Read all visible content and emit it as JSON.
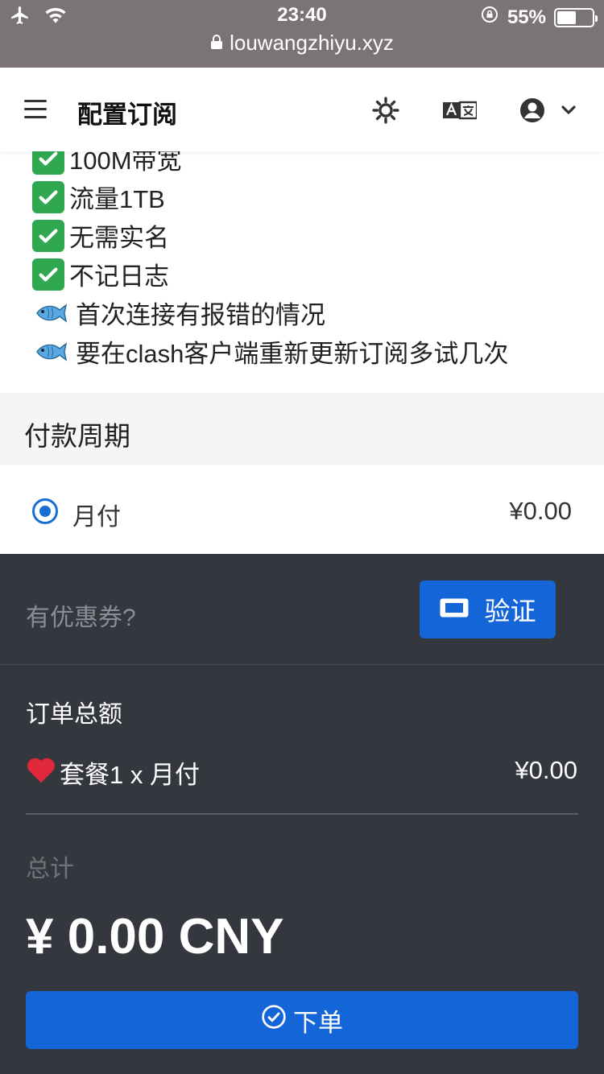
{
  "status_bar": {
    "time": "23:40",
    "battery_percent": "55%",
    "battery_level": 0.55,
    "url": "louwangzhiyu.xyz"
  },
  "header": {
    "title": "配置订阅"
  },
  "features": [
    {
      "icon": "check-icon",
      "text": "100M带宽"
    },
    {
      "icon": "check-icon",
      "text": "流量1TB"
    },
    {
      "icon": "check-icon",
      "text": "无需实名"
    },
    {
      "icon": "check-icon",
      "text": "不记日志"
    },
    {
      "icon": "fish-icon",
      "text": "首次连接有报错的情况"
    },
    {
      "icon": "fish-icon",
      "text": "要在clash客户端重新更新订阅多试几次"
    }
  ],
  "payment_period": {
    "title": "付款周期",
    "option_label": "月付",
    "option_price": "¥0.00"
  },
  "coupon": {
    "prompt": "有优惠券?",
    "verify_label": "验证"
  },
  "order_summary": {
    "title": "订单总额",
    "item_label": "套餐1 x 月付",
    "item_price": "¥0.00",
    "total_label": "总计",
    "total_amount": "¥ 0.00 CNY",
    "submit_label": "下单"
  },
  "colors": {
    "accent": "#1466d8",
    "dark_panel": "#34373d",
    "check_green": "#2fa84f"
  }
}
